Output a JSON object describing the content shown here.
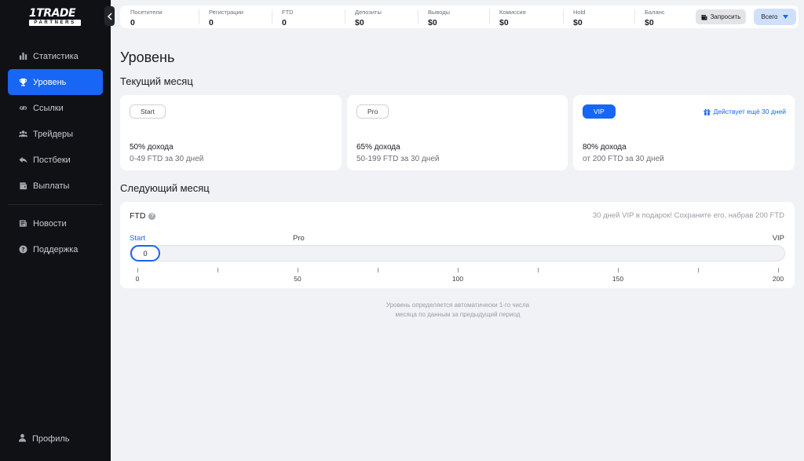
{
  "brand": {
    "name": "1TRADE",
    "sub": "PARTNERS"
  },
  "sidebar": {
    "items": [
      {
        "label": "Статистика",
        "icon": "bar-chart-icon"
      },
      {
        "label": "Уровень",
        "icon": "trophy-icon",
        "active": true
      },
      {
        "label": "Ссылки",
        "icon": "link-icon"
      },
      {
        "label": "Трейдеры",
        "icon": "users-icon"
      },
      {
        "label": "Постбеки",
        "icon": "reply-icon"
      },
      {
        "label": "Выплаты",
        "icon": "wallet-icon"
      }
    ],
    "secondary": [
      {
        "label": "Новости",
        "icon": "news-icon"
      },
      {
        "label": "Поддержка",
        "icon": "help-icon"
      }
    ],
    "profile": "Профиль"
  },
  "topbar": {
    "stats": [
      {
        "label": "Посетители",
        "value": "0"
      },
      {
        "label": "Регистрации",
        "value": "0"
      },
      {
        "label": "FTD",
        "value": "0"
      },
      {
        "label": "Депозиты",
        "value": "$0"
      },
      {
        "label": "Выводы",
        "value": "$0"
      },
      {
        "label": "Комиссия",
        "value": "$0"
      },
      {
        "label": "Hold",
        "value": "$0"
      },
      {
        "label": "Баланс",
        "value": "$0"
      }
    ],
    "request_label": "Запросить",
    "period_label": "Всего"
  },
  "page": {
    "title": "Уровень",
    "current_month": "Текущий месяц",
    "next_month": "Следующий месяц",
    "footnote_line1": "Уровень определяется автоматически 1-го числа",
    "footnote_line2": "месяца по данным за предыдущий период"
  },
  "tiers": [
    {
      "name": "Start",
      "percent": "50% дохода",
      "desc": "0-49 FTD за 30 дней"
    },
    {
      "name": "Pro",
      "percent": "65% дохода",
      "desc": "50-199 FTD за 30 дней"
    },
    {
      "name": "VIP",
      "percent": "80% дохода",
      "desc": "от 200 FTD за 30 дней",
      "current": true,
      "valid_note": "Действует ещё 30 дней"
    }
  ],
  "progress": {
    "label": "FTD",
    "note": "30 дней VIP в подарок! Сохраните его, набрав 200 FTD",
    "levels": [
      "Start",
      "Pro",
      "VIP"
    ],
    "value": 0,
    "value_label": "0",
    "max": 200,
    "tick_labels": [
      "0",
      "50",
      "100",
      "150",
      "200"
    ]
  },
  "colors": {
    "accent": "#1766f5",
    "sidebar_bg": "#101115",
    "page_bg": "#f1f2f5"
  }
}
